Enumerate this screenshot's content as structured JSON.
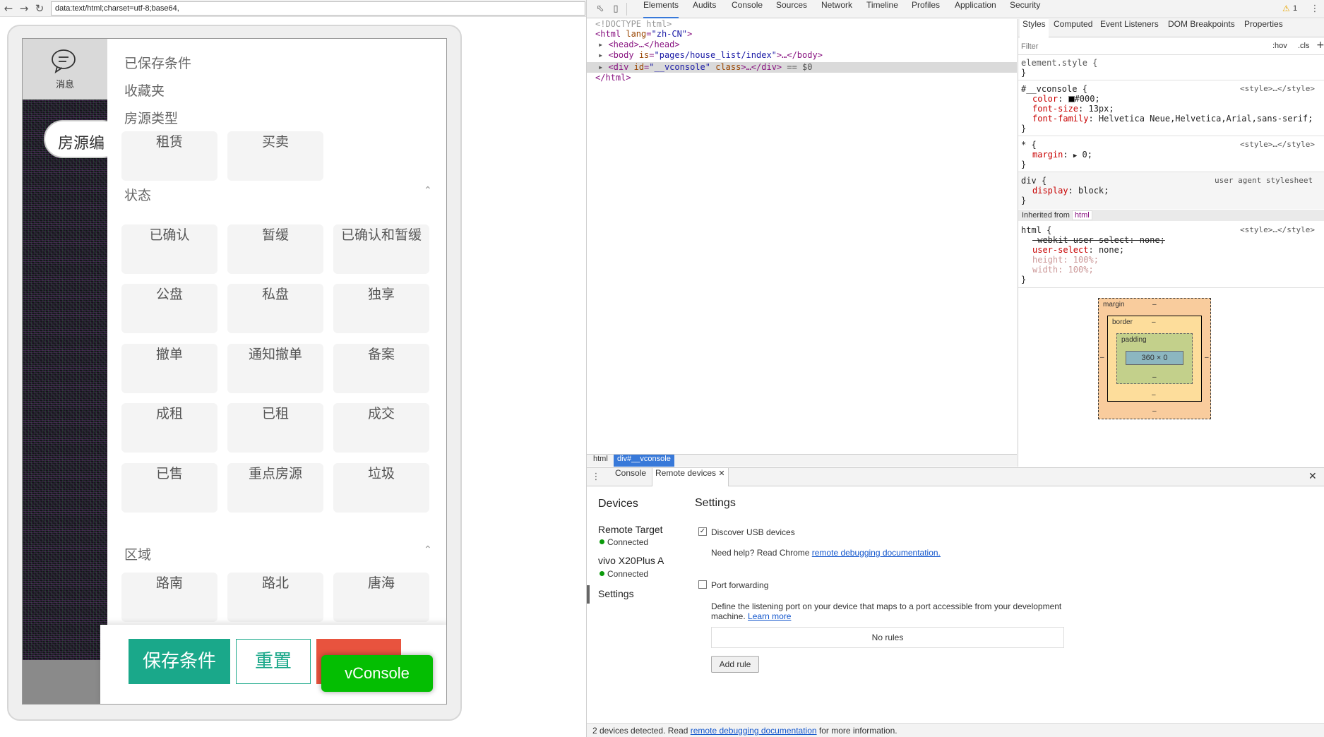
{
  "browser": {
    "url": "data:text/html;charset=utf-8;base64,"
  },
  "app": {
    "message_label": "消息",
    "house_pill": "房源编",
    "filter": {
      "saved_conditions": "已保存条件",
      "favorites": "收藏夹",
      "house_type": "房源类型",
      "type_options": [
        "租赁",
        "买卖"
      ],
      "status_title": "状态",
      "status_options": [
        "已确认",
        "暂缓",
        "已确认和暂缓",
        "公盘",
        "私盘",
        "独享",
        "撤单",
        "通知撤单",
        "备案",
        "成租",
        "已租",
        "成交",
        "已售",
        "重点房源",
        "垃圾"
      ],
      "region_title": "区域",
      "region_options": [
        "路南",
        "路北",
        "唐海"
      ],
      "collapse_icon": "chevron-up-icon"
    },
    "actions": {
      "save": "保存条件",
      "reset": "重置",
      "vconsole": "vConsole"
    },
    "colors": {
      "primary": "#1aa88a",
      "danger": "#e8533e",
      "vconsole": "#04be02"
    }
  },
  "devtools": {
    "tabs": [
      "Elements",
      "Audits",
      "Console",
      "Sources",
      "Network",
      "Timeline",
      "Profiles",
      "Application",
      "Security"
    ],
    "active_tab": "Elements",
    "warning_count": "1",
    "dom": {
      "doctype": "<!DOCTYPE html>",
      "html_open_tag": "<html",
      "html_lang_attr": "lang",
      "html_lang_val": "\"zh-CN\"",
      "head": "<head>…</head>",
      "body_prefix": "<body",
      "body_attr": "is",
      "body_val": "\"pages/house_list/index\"",
      "body_suffix": ">…</body>",
      "div_prefix": "<div",
      "div_id_attr": "id",
      "div_id_val": "\"__vconsole\"",
      "div_class_attr": "class",
      "div_suffix": ">…</div>",
      "selected_marker": "== $0",
      "html_close": "</html>"
    },
    "breadcrumbs": [
      "html",
      "div#__vconsole"
    ],
    "styles_tabs": [
      "Styles",
      "Computed",
      "Event Listeners",
      "DOM Breakpoints",
      "Properties"
    ],
    "filter_placeholder": "Filter",
    "hov": ":hov",
    "cls": ".cls",
    "rules": {
      "element_style": "element.style {",
      "close_brace": "}",
      "vconsole_selector": "#__vconsole {",
      "source_style": "<style>…</style>",
      "color_prop": "color",
      "color_val": "#000;",
      "fontsize_prop": "font-size",
      "fontsize_val": "13px;",
      "fontfamily_prop": "font-family",
      "fontfamily_val": "Helvetica Neue,Helvetica,Arial,sans-serif;",
      "star_selector": "* {",
      "margin_prop": "margin",
      "margin_val": "0;",
      "div_selector": "div {",
      "ua_source": "user agent stylesheet",
      "display_prop": "display",
      "display_val": "block;",
      "inherited_from": "Inherited from",
      "inherited_tag": "html",
      "html_selector": "html {",
      "webkit_user_select": "-webkit-user-select: none;",
      "user_select_prop": "user-select",
      "user_select_val": "none;",
      "height_decl": "height: 100%;",
      "width_decl": "width: 100%;"
    },
    "box_model": {
      "margin": "margin",
      "border": "border",
      "padding": "padding",
      "content": "360 × 0",
      "dash": "–"
    },
    "drawer": {
      "tabs": [
        "Console",
        "Remote devices"
      ],
      "active": "Remote devices",
      "devices_title": "Devices",
      "devices": [
        {
          "name": "Remote Target",
          "status": "Connected"
        },
        {
          "name": "vivo X20Plus A",
          "status": "Connected"
        }
      ],
      "settings_item": "Settings",
      "settings_title": "Settings",
      "discover_usb": "Discover USB devices",
      "discover_checked": true,
      "help_text": "Need help? Read Chrome",
      "help_link": "remote debugging documentation.",
      "port_forwarding": "Port forwarding",
      "port_checked": false,
      "port_desc_1": "Define the listening port on your device that maps to a port accessible from your development",
      "port_desc_2": "machine.",
      "learn_more": "Learn more",
      "no_rules": "No rules",
      "add_rule": "Add rule",
      "status_prefix": "2 devices detected. Read",
      "status_link": "remote debugging documentation",
      "status_suffix": "for more information."
    }
  }
}
